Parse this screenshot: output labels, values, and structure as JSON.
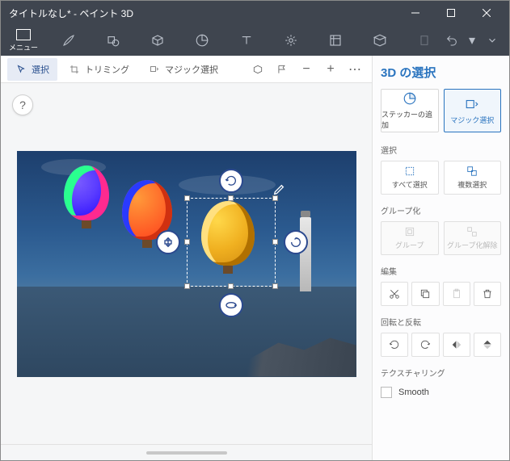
{
  "window": {
    "title": "タイトルなし* - ペイント 3D"
  },
  "ribbon": {
    "menu_label": "メニュー"
  },
  "subbar": {
    "select": "選択",
    "crop": "トリミング",
    "magic": "マジック選択"
  },
  "help": "?",
  "panel": {
    "title": "3D の選択",
    "sticker_add": "ステッカーの追加",
    "magic_select": "マジック選択",
    "section_select": "選択",
    "select_all": "すべて選択",
    "multi_select": "複数選択",
    "section_group": "グループ化",
    "group": "グループ",
    "ungroup": "グループ化解除",
    "section_edit": "編集",
    "section_rotate": "回転と反転",
    "section_texture": "テクスチャリング",
    "smooth": "Smooth"
  }
}
